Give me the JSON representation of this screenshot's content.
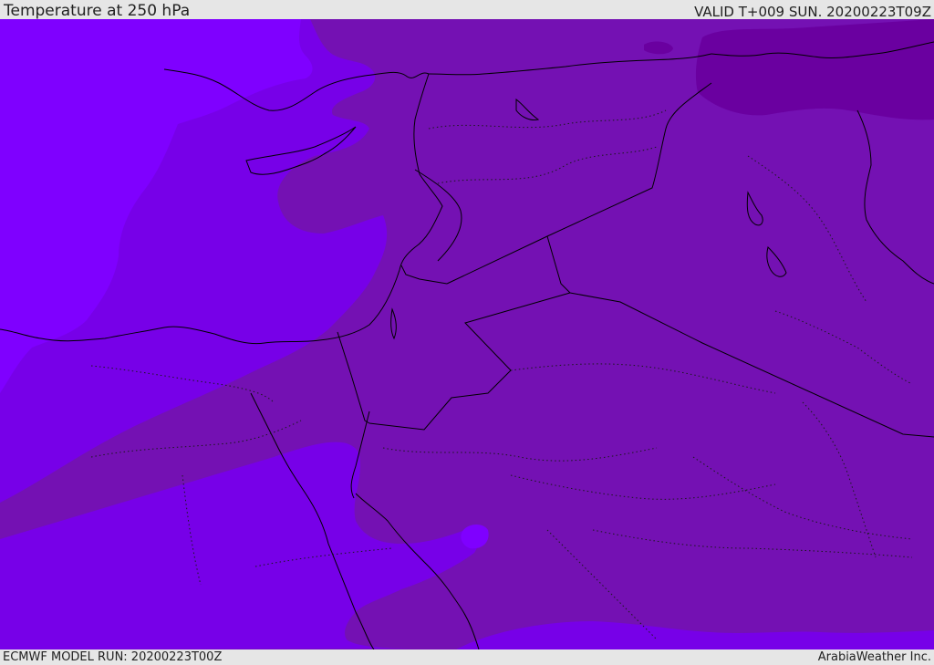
{
  "header": {
    "title": "Temperature at 250 hPa",
    "valid": "VALID T+009 SUN. 20200223T09Z"
  },
  "footer": {
    "model_run": "ECMWF MODEL RUN: 20200223T00Z",
    "credit": "ArabiaWeather Inc."
  },
  "map": {
    "colors": {
      "band_warmest": "#7f00ff",
      "band_warm": "#7700e8",
      "band_mid": "#750fbd",
      "band_cool": "#7411b3",
      "band_coolest": "#6a00a0",
      "coastline": "#000000",
      "border": "#000000"
    }
  }
}
